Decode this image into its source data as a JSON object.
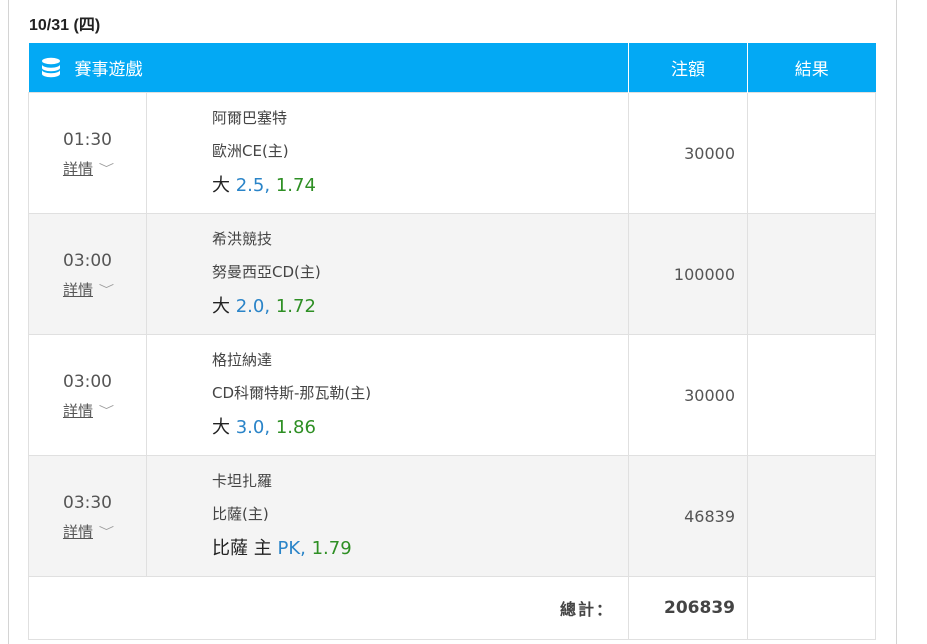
{
  "date": "10/31 (四)",
  "header": {
    "game_label": "賽事遊戲",
    "stake_label": "注額",
    "result_label": "結果"
  },
  "detail_label": "詳情",
  "bets": [
    {
      "time": "01:30",
      "team_a": "阿爾巴塞特",
      "team_b": "歐洲CE(主)",
      "selection": "大",
      "handicap": "2.5,",
      "odds": "1.74",
      "stake": "30000",
      "result": ""
    },
    {
      "time": "03:00",
      "team_a": "希洪競技",
      "team_b": "努曼西亞CD(主)",
      "selection": "大",
      "handicap": "2.0,",
      "odds": "1.72",
      "stake": "100000",
      "result": ""
    },
    {
      "time": "03:00",
      "team_a": "格拉納達",
      "team_b": "CD科爾特斯-那瓦勒(主)",
      "selection": "大",
      "handicap": "3.0,",
      "odds": "1.86",
      "stake": "30000",
      "result": ""
    },
    {
      "time": "03:30",
      "team_a": "卡坦扎羅",
      "team_b": "比薩(主)",
      "selection": "比薩 主",
      "handicap": "PK,",
      "odds": "1.79",
      "stake": "46839",
      "result": ""
    }
  ],
  "total": {
    "label": "總計：",
    "value": "206839"
  },
  "colors": {
    "header_bg": "#03a9f4",
    "handicap": "#2a84c8",
    "odds": "#2e8f24"
  }
}
